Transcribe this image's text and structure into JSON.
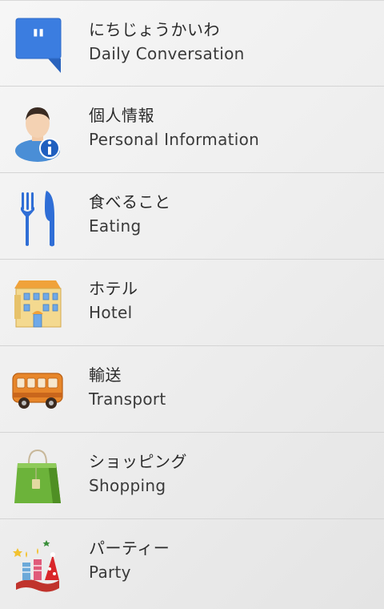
{
  "categories": [
    {
      "title_ja": "にちじょうかいわ",
      "title_en": "Daily Conversation",
      "icon": "quote-bubble-icon"
    },
    {
      "title_ja": "個人情報",
      "title_en": "Personal Information",
      "icon": "person-info-icon"
    },
    {
      "title_ja": "食べること",
      "title_en": "Eating",
      "icon": "fork-knife-icon"
    },
    {
      "title_ja": "ホテル",
      "title_en": "Hotel",
      "icon": "hotel-icon"
    },
    {
      "title_ja": "輸送",
      "title_en": "Transport",
      "icon": "bus-icon"
    },
    {
      "title_ja": "ショッピング",
      "title_en": "Shopping",
      "icon": "shopping-bag-icon"
    },
    {
      "title_ja": "パーティー",
      "title_en": "Party",
      "icon": "party-icon"
    }
  ]
}
